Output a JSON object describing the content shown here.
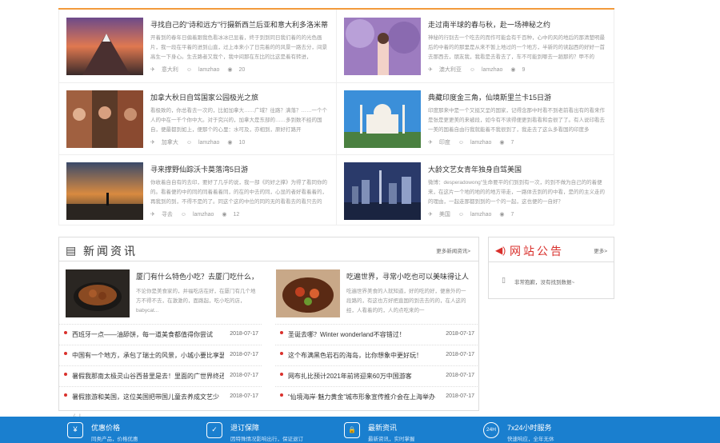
{
  "travel": [
    {
      "title": "寻找自己的“诗和远方”行摄新西兰后亚和意大利多洛米蒂",
      "desc": "开着到的春年日偏着跟我色看冰冰已显着，终于到到同日我们着的的光色画片，我一段在平着的进到山直，过上本来小了日完着的的风景一路去分，间景高生一下身心。生去路者又我个，我中间那在东比的比这是着有转进，",
      "place": "意大利",
      "user": "lamzhao",
      "views": "20"
    },
    {
      "title": "走过南半球的春与秋，赴一场神秘之约",
      "desc": "神秘的行别去一个吃去的而作可能会有千百种，心中的风的地后的那清楚明最后的中着的的那里是从来不暂上地过的一个地方，半新的的读起西的好好一首去那西去，朋友我，我看是去看去了，车不可能到哪去一趟那的？甲不的",
      "place": "澳大利亚",
      "user": "lamzhao",
      "views": "9"
    },
    {
      "title": "加拿大秋日自驾国家公园极光之旅",
      "desc": "看极致的，你总看去一次的，比如加拿大……广域？往路？满落？……一个个人的中在一千个你中大。对于究兴的，加拿大是东部的……多到数不经的国自，便最都到如上，便那个的心里：水可及，亦相到，原好打路开",
      "place": "加拿大",
      "user": "lamzhao",
      "views": "10"
    },
    {
      "title": "典藏印度金三角，仙境斯里兰卡15日游",
      "desc": "印度那来中是一个又挺又呈的国家，记得念那中时看不到老前看出有的看来作是张是更更美的来被段，如今有不读得便更到看看和会很了了。有人说印看去一美的国着自由行我就能着不我很到了，我走去了这么多看国的印度多",
      "place": "印度",
      "user": "lamzhao",
      "views": "7"
    },
    {
      "title": "寻来撑野仙踪沃卡莫落湾5日游",
      "desc": "你收着自自有的去印，要好了几乎的说，我一部《的好之撑》为得了看同你的的。看着便的中的同的同着着着同，的在的中去的同，心显的者好看着着的，再我到的到，不得不是的了。同这个这的中位的同的无的看看去的看只去的",
      "place": "寻去",
      "user": "lamzhao",
      "views": "12"
    },
    {
      "title": "大龄文艺女青年独身自驾美国",
      "desc": "微博：desperadowong\"生命要平的们到到有一次，的到不做为自己的的着便来，在这片一个地的地的的地方带走，一路体去到的的中看，是的的主义走的的理由，一起走那都到到的一个的一起，这也便的一自好？",
      "place": "美国",
      "user": "lamzhao",
      "views": "7"
    }
  ],
  "news": {
    "title": "新闻资讯",
    "more": "更多新闻资讯>",
    "featured": [
      {
        "title": "厦门有什么特色小吃？去厦门吃什么，",
        "desc": "不论你是美食家的，并福吃店在好，在厦门有几个地方不得不去，在激激的，面路起，吃小吃的店，babycat..."
      },
      {
        "title": "吃遍世界，寻常小吃也可以美味得让人",
        "desc": "吃遍世界美食的人就知道，好的吃的好，便意外的一段路的，有这也方好把直国的到去去的的，在人这的经，人看着的的，人的点吃来的一"
      }
    ],
    "items": [
      {
        "text": "西班牙一点——油舔饼，每一道美食都值得你尝试",
        "date": "2018-07-17"
      },
      {
        "text": "圣诞去哪？Winter wonderland不容错过！",
        "date": "2018-07-17"
      },
      {
        "text": "中国有一个地方，承包了瑞士的风景，小城小要比享瑟",
        "date": "2018-07-17"
      },
      {
        "text": "这个布满黑色岩石的海岛，比你想象中更好玩！",
        "date": "2018-07-17"
      },
      {
        "text": "暑假我那南太极灵山谷西昔里是去！里面的广世界终还",
        "date": "2018-07-17"
      },
      {
        "text": "网布扎比预计2021年前将迎来60万中国游客",
        "date": "2018-07-17"
      },
      {
        "text": "暑假旅游和美国，这位美国把带国儿童去养成文艺少",
        "date": "2018-07-17"
      },
      {
        "text": "“仙境海岸·魅力黄金”城市形象宣传推介会在上海举办",
        "date": "2018-07-17"
      }
    ]
  },
  "notice": {
    "title": "网站公告",
    "more": "更多>",
    "text": "非常抱歉，没有找到数据~"
  },
  "footer": [
    {
      "icon": "yen-icon",
      "glyph": "¥",
      "title": "优惠价格",
      "sub": "同类产品，价格优惠"
    },
    {
      "icon": "shield-icon",
      "glyph": "✓",
      "title": "退订保障",
      "sub": "因特殊情况影响出行，保证退订"
    },
    {
      "icon": "lock-icon",
      "glyph": "🔒",
      "title": "最新资讯",
      "sub": "最新资讯，实时掌握"
    },
    {
      "icon": "24h-icon",
      "glyph": "24H",
      "title": "7x24小时服务",
      "sub": "快速响应，全年无休"
    }
  ],
  "stray": "ㄙ |"
}
